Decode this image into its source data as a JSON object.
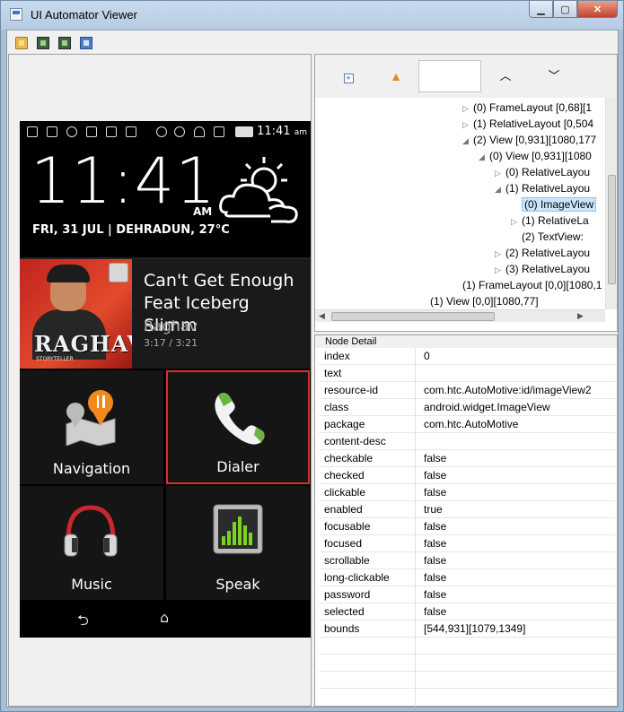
{
  "window": {
    "title": "UI Automator Viewer"
  },
  "device": {
    "status_time": "11:41",
    "status_ampm": "am",
    "clock_time": "11:41",
    "clock_ampm": "AM",
    "clock_date": "FRI, 31 JUL | DEHRADUN, 27°C",
    "album_title": "RAGHAV",
    "album_sub": "STORYTELLER",
    "track_title": "Can't Get Enough Feat Iceberg Slimm",
    "track_artist": "Raghav",
    "track_time": "3:17 / 3:21",
    "tiles": {
      "navigation": "Navigation",
      "dialer": "Dialer",
      "music": "Music",
      "speak": "Speak"
    },
    "nav_back": "⮌",
    "nav_home": "⌂"
  },
  "tree": {
    "rows": [
      "(0) FrameLayout [0,68][1",
      "(1) RelativeLayout [0,504",
      "(2) View [0,931][1080,177",
      "(0) View [0,931][1080",
      "(0) RelativeLayou",
      "(1) RelativeLayou",
      "(0) ImageView",
      "(1) RelativeLa",
      "(2) TextView:",
      "(2) RelativeLayou",
      "(3) RelativeLayou",
      "(1) FrameLayout [0,0][1080,1",
      "(1) View [0,0][1080,77]"
    ]
  },
  "detail": {
    "title": "Node Detail",
    "rows": [
      {
        "key": "index",
        "value": "0"
      },
      {
        "key": "text",
        "value": ""
      },
      {
        "key": "resource-id",
        "value": "com.htc.AutoMotive:id/imageView2"
      },
      {
        "key": "class",
        "value": "android.widget.ImageView"
      },
      {
        "key": "package",
        "value": "com.htc.AutoMotive"
      },
      {
        "key": "content-desc",
        "value": ""
      },
      {
        "key": "checkable",
        "value": "false"
      },
      {
        "key": "checked",
        "value": "false"
      },
      {
        "key": "clickable",
        "value": "false"
      },
      {
        "key": "enabled",
        "value": "true"
      },
      {
        "key": "focusable",
        "value": "false"
      },
      {
        "key": "focused",
        "value": "false"
      },
      {
        "key": "scrollable",
        "value": "false"
      },
      {
        "key": "long-clickable",
        "value": "false"
      },
      {
        "key": "password",
        "value": "false"
      },
      {
        "key": "selected",
        "value": "false"
      },
      {
        "key": "bounds",
        "value": "[544,931][1079,1349]"
      }
    ]
  }
}
